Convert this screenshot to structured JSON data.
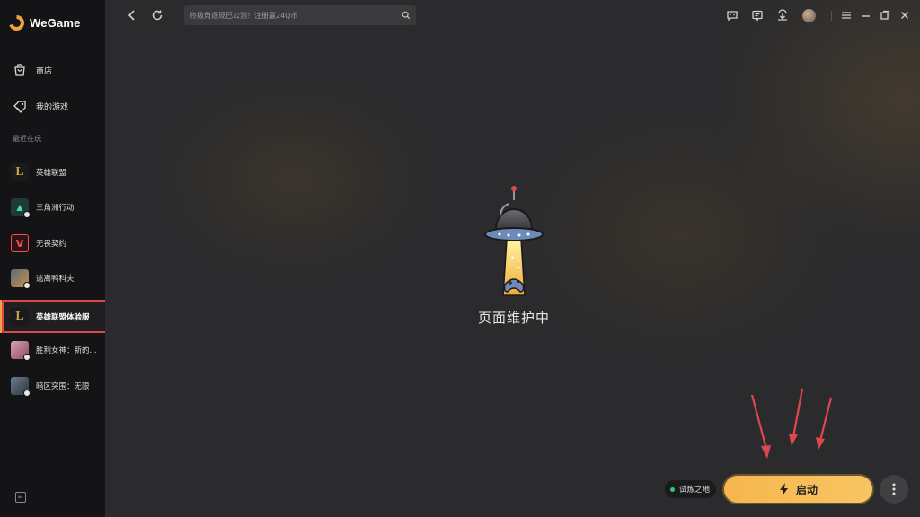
{
  "app": {
    "brand": "WeGame"
  },
  "sidebar": {
    "nav": [
      {
        "label": "商店",
        "icon": "shop-bag-icon"
      },
      {
        "label": "我的游戏",
        "icon": "gamepad-tag-icon"
      }
    ],
    "recent_label": "最近在玩",
    "games": [
      {
        "label": "英雄联盟",
        "icon": "league-logo-icon"
      },
      {
        "label": "三角洲行动",
        "icon": "delta-force-icon"
      },
      {
        "label": "无畏契约",
        "icon": "valorant-logo-icon"
      },
      {
        "label": "逃离鸭科夫",
        "icon": "duck-game-icon"
      },
      {
        "label": "英雄联盟体验服",
        "icon": "league-logo-icon",
        "active": true
      },
      {
        "label": "胜利女神：新的...",
        "icon": "nikke-avatar-icon"
      },
      {
        "label": "暗区突围：无限",
        "icon": "arena-breakout-icon"
      }
    ]
  },
  "topbar": {
    "search_placeholder": "终极角逐现已公测！注册赢24Q币"
  },
  "main": {
    "maintenance_text": "页面维护中"
  },
  "footer": {
    "server_label": "试炼之地",
    "launch_label": "启动"
  },
  "colors": {
    "accent": "#f6b64f",
    "highlight": "#e0474c",
    "status_online": "#2ecc71"
  }
}
